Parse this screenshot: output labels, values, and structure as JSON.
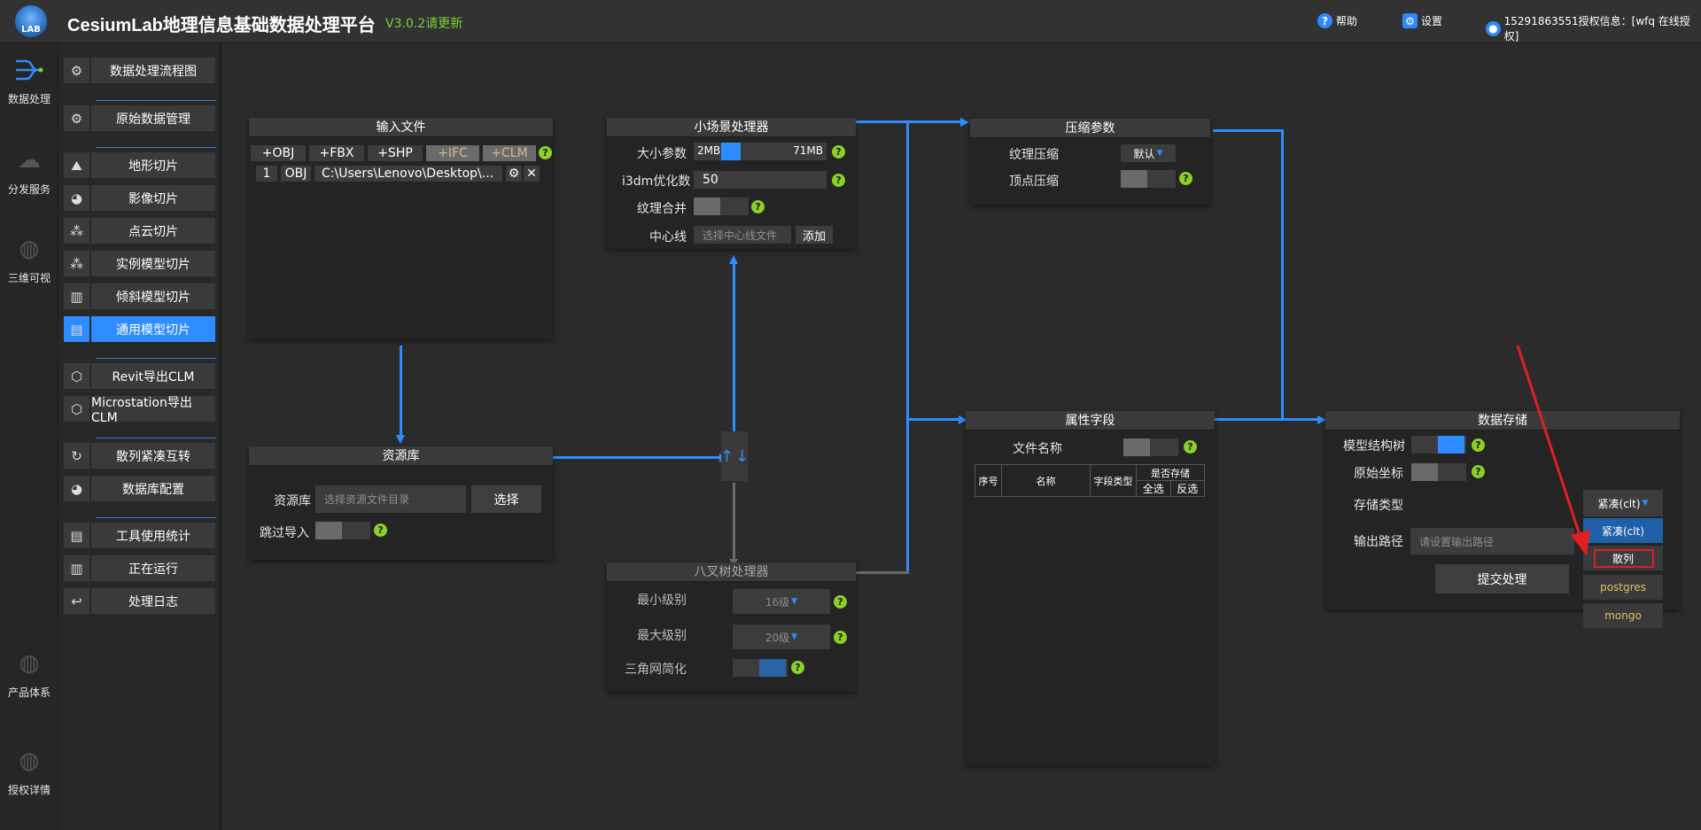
{
  "header": {
    "logo_text": "LAB",
    "title": "CesiumLab地理信息基础数据处理平台",
    "version": "V3.0.2请更新",
    "help": "帮助",
    "settings": "设置",
    "user": "15291863551授权信息：[wfq 在线授权]"
  },
  "leftnav": [
    {
      "label": "数据处理",
      "icon": "flow-icon"
    },
    {
      "label": "分发服务",
      "icon": "cloud-icon"
    },
    {
      "label": "三维可视",
      "icon": "globe-icon"
    },
    {
      "label": "产品体系",
      "icon": "globe-icon"
    },
    {
      "label": "授权详情",
      "icon": "globe-icon"
    }
  ],
  "menu": [
    "数据处理流程图",
    "原始数据管理",
    "地形切片",
    "影像切片",
    "点云切片",
    "实例模型切片",
    "倾斜模型切片",
    "通用模型切片",
    "Revit导出CLM",
    "Microstation导出CLM",
    "散列紧凑互转",
    "数据库配置",
    "工具使用统计",
    "正在运行",
    "处理日志"
  ],
  "input_panel": {
    "title": "输入文件",
    "formats": [
      "+OBJ",
      "+FBX",
      "+SHP",
      "+IFC",
      "+CLM"
    ],
    "row": {
      "index": "1",
      "type": "OBJ",
      "path": "C:\\Users\\Lenovo\\Desktop\\..."
    }
  },
  "resource_panel": {
    "title": "资源库",
    "label": "资源库",
    "placeholder": "选择资源文件目录",
    "select_btn": "选择",
    "skip_label": "跳过导入"
  },
  "small_scene": {
    "title": "小场景处理器",
    "size_label": "大小参数",
    "size_min": "2MB",
    "size_max": "71MB",
    "size_value": 0.05,
    "i3dm_label": "i3dm优化数",
    "i3dm_value": "50",
    "merge_label": "纹理合并",
    "centerline_label": "中心线",
    "centerline_placeholder": "选择中心线文件",
    "add_btn": "添加"
  },
  "octree": {
    "title": "八叉树处理器",
    "min_label": "最小级别",
    "min_value": "16级",
    "max_label": "最大级别",
    "max_value": "20级",
    "simplify_label": "三角网简化"
  },
  "compress": {
    "title": "压缩参数",
    "texture_label": "纹理压缩",
    "texture_value": "默认",
    "vertex_label": "顶点压缩"
  },
  "attr": {
    "title": "属性字段",
    "filename_label": "文件名称",
    "cols": [
      "序号",
      "名称",
      "字段类型",
      "是否存储"
    ],
    "select_all": "全选",
    "invert": "反选"
  },
  "storage": {
    "title": "数据存储",
    "tree_label": "模型结构树",
    "coord_label": "原始坐标",
    "type_label": "存储类型",
    "type_value": "紧凑(clt)",
    "output_label": "输出路径",
    "output_placeholder": "请设置输出路径",
    "submit": "提交处理",
    "options": [
      "紧凑(clt)",
      "散列",
      "postgres",
      "mongo"
    ]
  },
  "colors": {
    "accent": "#2e8cff",
    "help": "#8ad029",
    "highlight": "#e02020"
  }
}
